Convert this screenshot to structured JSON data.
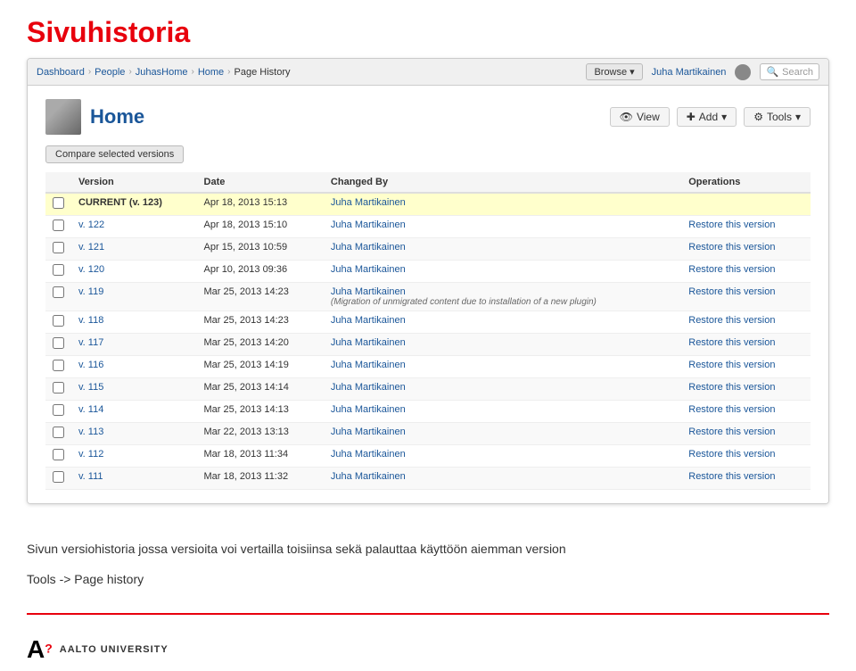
{
  "pageTitle": "Sivuhistoria",
  "breadcrumb": {
    "items": [
      "Dashboard",
      "People",
      "JuhasHome",
      "Home",
      "Page History"
    ]
  },
  "nav": {
    "browseLabel": "Browse",
    "userName": "Juha Martikainen",
    "searchPlaceholder": "Search"
  },
  "pageHeader": {
    "title": "Home",
    "viewLabel": "View",
    "addLabel": "Add",
    "toolsLabel": "Tools"
  },
  "compareButton": "Compare selected versions",
  "tableHeaders": {
    "version": "Version",
    "date": "Date",
    "changedBy": "Changed By",
    "operations": "Operations"
  },
  "rows": [
    {
      "version": "CURRENT (v. 123)",
      "isCurrent": true,
      "date": "Apr 18, 2013 15:13",
      "changedBy": "Juha Martikainen",
      "operation": "",
      "note": ""
    },
    {
      "version": "v. 122",
      "isCurrent": false,
      "date": "Apr 18, 2013 15:10",
      "changedBy": "Juha Martikainen",
      "operation": "Restore this version",
      "note": ""
    },
    {
      "version": "v. 121",
      "isCurrent": false,
      "date": "Apr 15, 2013 10:59",
      "changedBy": "Juha Martikainen",
      "operation": "Restore this version",
      "note": ""
    },
    {
      "version": "v. 120",
      "isCurrent": false,
      "date": "Apr 10, 2013 09:36",
      "changedBy": "Juha Martikainen",
      "operation": "Restore this version",
      "note": ""
    },
    {
      "version": "v. 119",
      "isCurrent": false,
      "date": "Mar 25, 2013 14:23",
      "changedBy": "Juha Martikainen",
      "operation": "Restore this version",
      "note": "(Migration of unmigrated content due to installation of a new plugin)"
    },
    {
      "version": "v. 118",
      "isCurrent": false,
      "date": "Mar 25, 2013 14:23",
      "changedBy": "Juha Martikainen",
      "operation": "Restore this version",
      "note": ""
    },
    {
      "version": "v. 117",
      "isCurrent": false,
      "date": "Mar 25, 2013 14:20",
      "changedBy": "Juha Martikainen",
      "operation": "Restore this version",
      "note": ""
    },
    {
      "version": "v. 116",
      "isCurrent": false,
      "date": "Mar 25, 2013 14:19",
      "changedBy": "Juha Martikainen",
      "operation": "Restore this version",
      "note": ""
    },
    {
      "version": "v. 115",
      "isCurrent": false,
      "date": "Mar 25, 2013 14:14",
      "changedBy": "Juha Martikainen",
      "operation": "Restore this version",
      "note": ""
    },
    {
      "version": "v. 114",
      "isCurrent": false,
      "date": "Mar 25, 2013 14:13",
      "changedBy": "Juha Martikainen",
      "operation": "Restore this version",
      "note": ""
    },
    {
      "version": "v. 113",
      "isCurrent": false,
      "date": "Mar 22, 2013 13:13",
      "changedBy": "Juha Martikainen",
      "operation": "Restore this version",
      "note": ""
    },
    {
      "version": "v. 112",
      "isCurrent": false,
      "date": "Mar 18, 2013 11:34",
      "changedBy": "Juha Martikainen",
      "operation": "Restore this version",
      "note": ""
    },
    {
      "version": "v. 111",
      "isCurrent": false,
      "date": "Mar 18, 2013 11:32",
      "changedBy": "Juha Martikainen",
      "operation": "Restore this version",
      "note": ""
    }
  ],
  "description": "Sivun versiohistoria jossa versioita voi vertailla toisiinsa sekä palauttaa käyttöön aiemman version",
  "toolsNote": "Tools -> Page history",
  "footer": {
    "logoLetter": "A",
    "logoQuestion": "?",
    "logoText": "Aalto University"
  }
}
